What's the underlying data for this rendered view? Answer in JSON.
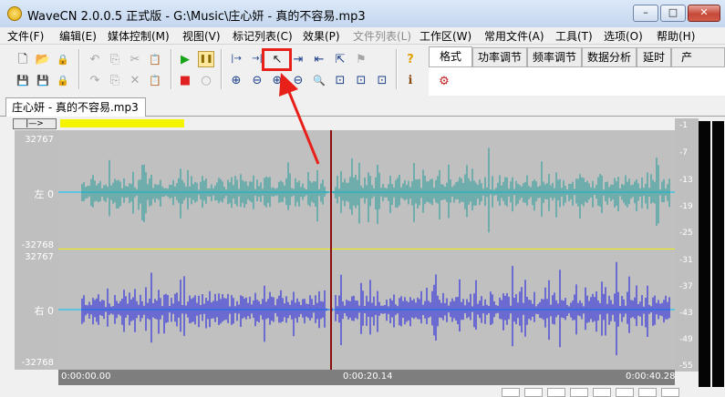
{
  "window": {
    "title": "WaveCN 2.0.0.5 正式版 - G:\\Music\\庄心妍 - 真的不容易.mp3",
    "min_label": "–",
    "max_label": "□",
    "close_label": "✕"
  },
  "menu": [
    {
      "label": "文件(F)",
      "enabled": true
    },
    {
      "label": "编辑(E)",
      "enabled": true
    },
    {
      "label": "媒体控制(M)",
      "enabled": true
    },
    {
      "label": "视图(V)",
      "enabled": true
    },
    {
      "label": "标记列表(C)",
      "enabled": true
    },
    {
      "label": "效果(P)",
      "enabled": true
    },
    {
      "label": "文件列表(L)",
      "enabled": false
    },
    {
      "label": "工作区(W)",
      "enabled": true
    },
    {
      "label": "常用文件(A)",
      "enabled": true
    },
    {
      "label": "工具(T)",
      "enabled": true
    },
    {
      "label": "选项(O)",
      "enabled": true
    },
    {
      "label": "帮助(H)",
      "enabled": true
    }
  ],
  "toolbar": {
    "new": "🗋",
    "open": "📂",
    "lock": "🔒",
    "save": "💾",
    "save_all": "💾",
    "lock2": "🔒",
    "undo": "↶",
    "copy": "⎘",
    "cut": "✂",
    "paste": "📋",
    "redo": "↷",
    "copy2": "⎘",
    "delete": "✕",
    "paste2": "📋",
    "play": "▶",
    "pause": "❚❚",
    "stop": "■",
    "record": "○",
    "sel_start": "|→",
    "sel_end": "→|",
    "select_tool": "↖",
    "mark1": "⇥",
    "mark2": "⇤",
    "mark3": "⇱",
    "flag": "⚑",
    "zoom_in_h": "⊕",
    "zoom_out_h": "⊖",
    "zoom_in": "⊕",
    "zoom_out": "⊖",
    "zoom_search": "🔍",
    "zoom_fit": "⊡",
    "zoom_sel": "⊡",
    "zoom_all": "⊡",
    "help": "?",
    "info": "ℹ"
  },
  "tabs": [
    "格式",
    "功率调节",
    "频率调节",
    "数据分析",
    "延时",
    "产"
  ],
  "tab_panel_icon": "⚙",
  "document_tab": "庄心妍 - 真的不容易.mp3",
  "nav_button": "|—>",
  "left_channel": {
    "top": "32767",
    "mid": "左 0",
    "bottom": "-32768"
  },
  "right_channel": {
    "top": "32767",
    "mid": "右 0",
    "bottom": "-32768"
  },
  "time_labels": [
    "0:00:00.00",
    "0:00:20.14",
    "0:00:40.28"
  ],
  "db_scale": [
    "-1",
    "-7",
    "-13",
    "-19",
    "-25",
    "-31",
    "-37",
    "-43",
    "-49",
    "-55"
  ],
  "colors": {
    "left_wave": "#1d9a98",
    "right_wave": "#1515e0",
    "cursor": "#8a0e0e",
    "highlight": "#e8201a"
  }
}
